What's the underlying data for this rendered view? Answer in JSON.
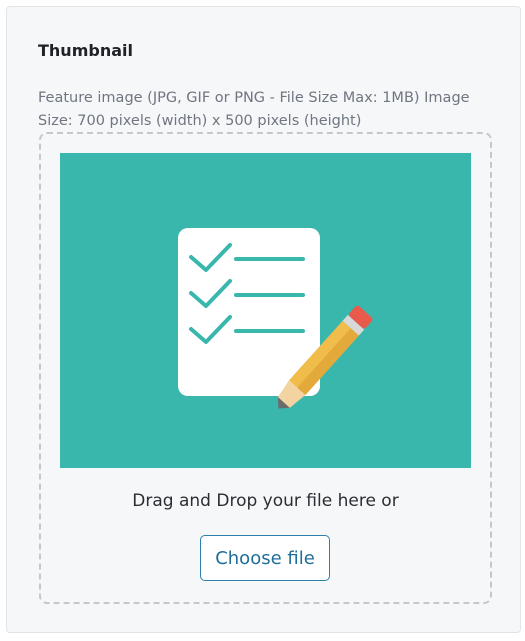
{
  "thumbnail_section": {
    "title": "Thumbnail",
    "description": "Feature image (JPG, GIF or PNG - File Size Max: 1MB) Image Size: 700 pixels (width) x 500 pixels (height)",
    "dropzone": {
      "text": "Drag and Drop your file here or",
      "button_label": "Choose file"
    },
    "placeholder_icon": "checklist-pencil-icon",
    "colors": {
      "placeholder_background": "#3ab7ac",
      "button_border": "#2d7fa8",
      "button_text": "#1f6e99"
    }
  }
}
